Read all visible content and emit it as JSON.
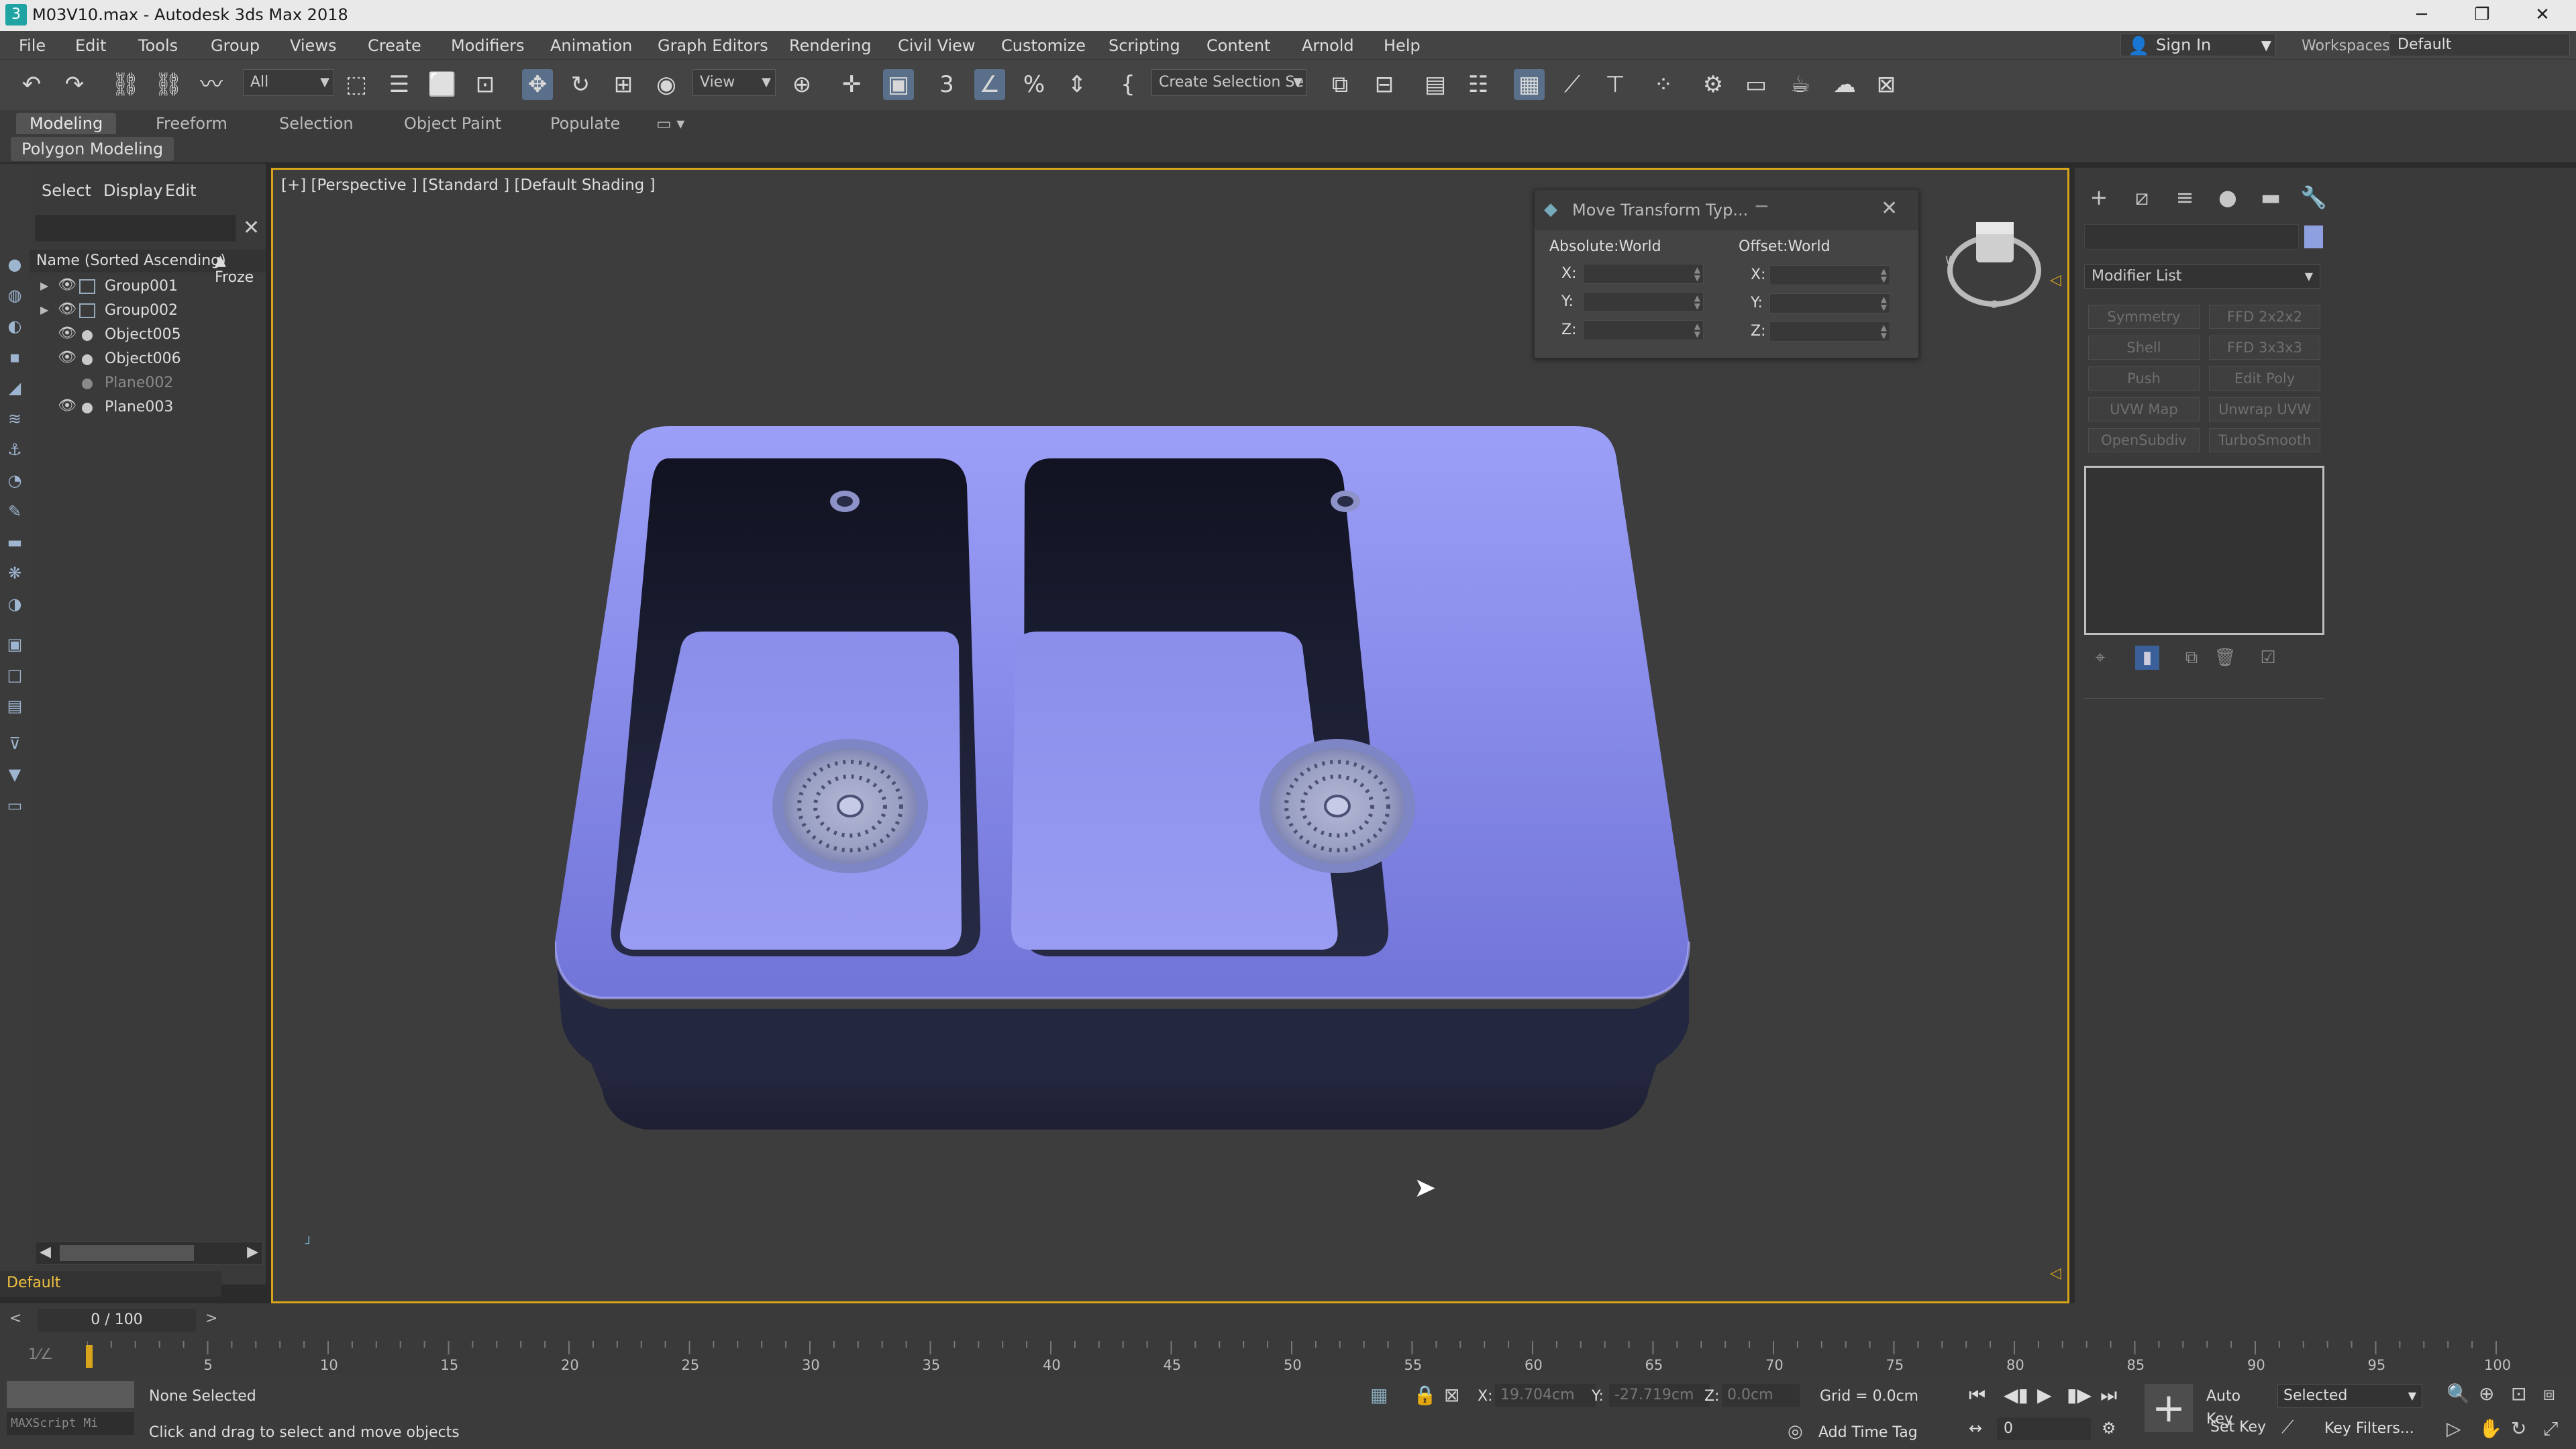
{
  "window": {
    "title": "M03V10.max - Autodesk 3ds Max 2018",
    "minimize": "─",
    "restore": "❐",
    "close": "✕"
  },
  "menubar": {
    "items": [
      "File",
      "Edit",
      "Tools",
      "Group",
      "Views",
      "Create",
      "Modifiers",
      "Animation",
      "Graph Editors",
      "Rendering",
      "Civil View",
      "Customize",
      "Scripting",
      "Content",
      "Arnold",
      "Help"
    ],
    "sign_in": "Sign In",
    "workspaces_label": "Workspaces:",
    "workspace_value": "Default"
  },
  "toolbar": {
    "selection_filter": "All",
    "reference_coord": "View",
    "named_selection_placeholder": "Create Selection Se"
  },
  "ribbon": {
    "tabs": [
      "Modeling",
      "Freeform",
      "Selection",
      "Object Paint",
      "Populate"
    ],
    "active_tab": "Modeling",
    "panel_label": "Polygon Modeling"
  },
  "scene_explorer": {
    "menus": [
      "Select",
      "Display",
      "Edit"
    ],
    "column_name": "Name (Sorted Ascending)",
    "column_frozen": "▲ Froze",
    "items": [
      {
        "name": "Group001",
        "kind": "group"
      },
      {
        "name": "Group002",
        "kind": "group"
      },
      {
        "name": "Object005",
        "kind": "object"
      },
      {
        "name": "Object006",
        "kind": "object"
      },
      {
        "name": "Plane002",
        "kind": "object",
        "hidden": true
      },
      {
        "name": "Plane003",
        "kind": "object"
      }
    ],
    "layer": "Default"
  },
  "viewport": {
    "label": "[+] [Perspective ] [Standard ] [Default Shading ]",
    "sink_color": "#8c8ff0",
    "sink_dark": "#24273f"
  },
  "move_transform_dialog": {
    "title": "Move Transform Typ...",
    "absolute_label": "Absolute:World",
    "offset_label": "Offset:World",
    "axes": [
      "X:",
      "Y:",
      "Z:"
    ]
  },
  "command_panel": {
    "modifier_list": "Modifier List",
    "buttons": [
      "Symmetry",
      "FFD 2x2x2",
      "Shell",
      "FFD 3x3x3",
      "Push",
      "Edit Poly",
      "UVW Map",
      "Unwrap UVW",
      "OpenSubdiv",
      "TurboSmooth"
    ],
    "object_color": "#8ea0e0"
  },
  "timeline": {
    "frame_display": "0 / 100",
    "ticks": [
      "5",
      "10",
      "15",
      "20",
      "25",
      "30",
      "35",
      "40",
      "45",
      "50",
      "55",
      "60",
      "65",
      "70",
      "75",
      "80",
      "85",
      "90",
      "95",
      "100"
    ]
  },
  "statusbar": {
    "maxscript_label": "MAXScript Mi",
    "selection_status": "None Selected",
    "prompt": "Click and drag to select and move objects",
    "x_label": "X:",
    "x_value": "19.704cm",
    "y_label": "Y:",
    "y_value": "-27.719cm",
    "z_label": "Z:",
    "z_value": "0.0cm",
    "grid": "Grid = 0.0cm",
    "add_time_tag": "Add Time Tag",
    "auto_key": "Auto Key",
    "set_key": "Set Key",
    "key_mode": "Selected",
    "key_filters": "Key Filters...",
    "current_frame": "0"
  }
}
